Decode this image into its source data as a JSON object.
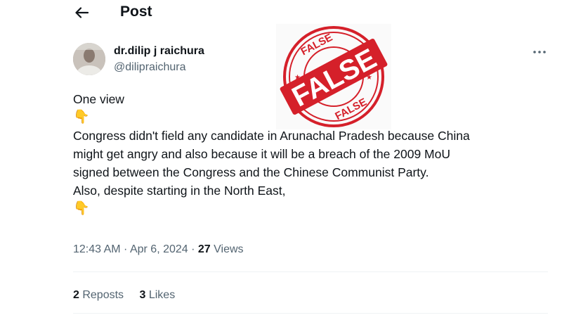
{
  "header": {
    "title": "Post",
    "back_icon": "arrow-left-icon"
  },
  "author": {
    "display_name": "dr.dilip j raichura",
    "handle": "@dilipraichura",
    "more_icon": "more-horizontal-icon"
  },
  "tweet": {
    "lines": [
      "One view",
      "👇",
      "Congress didn't field any candidate in Arunachal Pradesh because China",
      "might get angry  and also because it will be a breach of the 2009 MoU",
      "signed between the Congress and the Chinese Communist Party.",
      "Also, despite starting in the North East,",
      "👇"
    ]
  },
  "meta": {
    "time": "12:43 AM",
    "sep1": " · ",
    "date": "Apr 6, 2024",
    "sep2": " · ",
    "views_count": "27",
    "views_label": " Views"
  },
  "stats": {
    "reposts_count": "2",
    "reposts_label": " Reposts",
    "likes_count": "3",
    "likes_label": " Likes"
  },
  "stamp": {
    "main_text": "FALSE",
    "small_text": "FALSE",
    "color": "#d5202a"
  }
}
